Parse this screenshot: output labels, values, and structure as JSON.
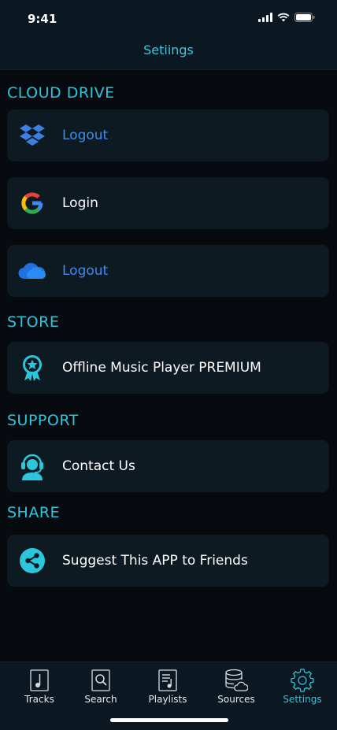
{
  "status_bar": {
    "time": "9:41"
  },
  "header": {
    "title": "Setiings"
  },
  "sections": {
    "cloud_drive": {
      "title": "CLOUD DRIVE",
      "items": [
        {
          "icon": "dropbox-icon",
          "label": "Logout"
        },
        {
          "icon": "google-icon",
          "label": "Login"
        },
        {
          "icon": "onedrive-icon",
          "label": "Logout"
        }
      ]
    },
    "store": {
      "title": "STORE",
      "items": [
        {
          "icon": "premium-badge-icon",
          "label": "Offline Music Player PREMIUM"
        }
      ]
    },
    "support": {
      "title": "SUPPORT",
      "items": [
        {
          "icon": "support-agent-icon",
          "label": "Contact Us"
        }
      ]
    },
    "share": {
      "title": "SHARE",
      "items": [
        {
          "icon": "share-icon",
          "label": "Suggest This APP to Friends"
        }
      ]
    }
  },
  "tabbar": {
    "tabs": [
      {
        "label": "Tracks",
        "icon": "music-note-icon"
      },
      {
        "label": "Search",
        "icon": "search-icon"
      },
      {
        "label": "Playlists",
        "icon": "playlist-icon"
      },
      {
        "label": "Sources",
        "icon": "database-cloud-icon"
      },
      {
        "label": "Settings",
        "icon": "gear-icon",
        "active": true
      }
    ]
  },
  "colors": {
    "accent": "#2cc6dc",
    "logout_blue": "#3d8bec",
    "background": "#070b10",
    "card": "#0e1a22"
  }
}
